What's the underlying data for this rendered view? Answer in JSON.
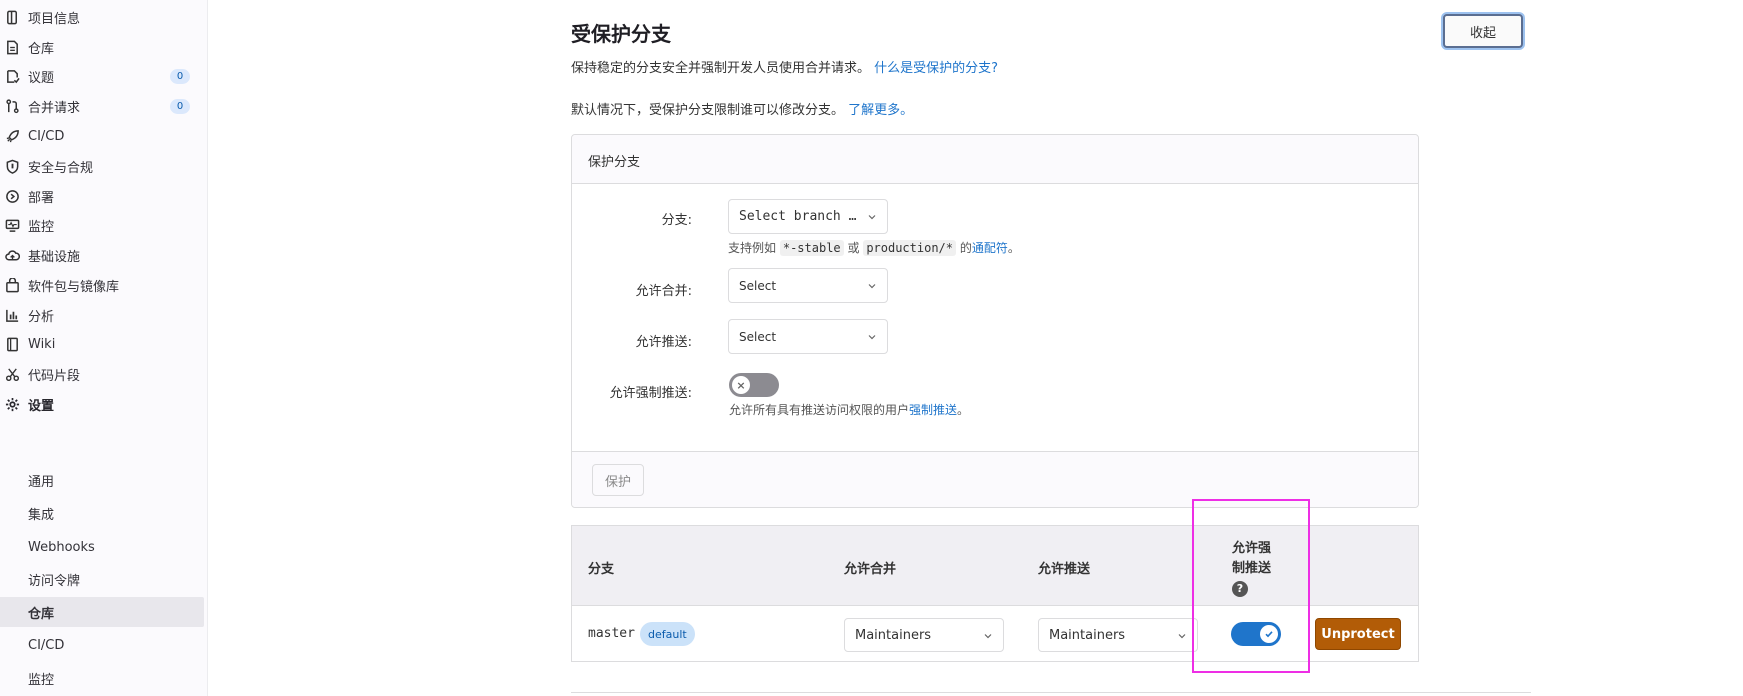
{
  "sidebar": {
    "items": [
      {
        "label": "项目信息",
        "icon": "project-info-icon"
      },
      {
        "label": "仓库",
        "icon": "repository-icon"
      },
      {
        "label": "议题",
        "icon": "issues-icon",
        "count": "0"
      },
      {
        "label": "合并请求",
        "icon": "merge-request-icon",
        "count": "0"
      },
      {
        "label": "CI/CD",
        "icon": "rocket-icon"
      },
      {
        "label": "安全与合规",
        "icon": "shield-icon"
      },
      {
        "label": "部署",
        "icon": "deployments-icon"
      },
      {
        "label": "监控",
        "icon": "monitor-icon"
      },
      {
        "label": "基础设施",
        "icon": "cloud-icon"
      },
      {
        "label": "软件包与镜像库",
        "icon": "package-icon"
      },
      {
        "label": "分析",
        "icon": "chart-icon"
      },
      {
        "label": "Wiki",
        "icon": "book-icon"
      },
      {
        "label": "代码片段",
        "icon": "scissors-icon"
      },
      {
        "label": "设置",
        "icon": "gear-icon"
      }
    ],
    "settings_sub": [
      "通用",
      "集成",
      "Webhooks",
      "访问令牌",
      "仓库",
      "CI/CD",
      "监控"
    ],
    "active_sub": "仓库"
  },
  "page": {
    "title": "受保护分支",
    "desc_text": "保持稳定的分支安全并强制开发人员使用合并请求。",
    "desc_link": "什么是受保护的分支?",
    "default_text": "默认情况下，受保护分支限制谁可以修改分支。",
    "default_link": "了解更多。",
    "collapse_label": "收起"
  },
  "form": {
    "header": "保护分支",
    "branch_label": "分支:",
    "branch_placeholder": "Select branch …",
    "branch_help_prefix": "支持例如",
    "branch_help_code1": "*-stable",
    "branch_help_or": "或",
    "branch_help_code2": "production/*",
    "branch_help_mid": "的",
    "branch_help_link": "通配符",
    "branch_help_end": "。",
    "merge_label": "允许合并:",
    "merge_value": "Select",
    "push_label": "允许推送:",
    "push_value": "Select",
    "force_label": "允许强制推送:",
    "force_help_prefix": "允许所有具有推送访问权限的用户",
    "force_help_link": "强制推送",
    "force_help_end": "。",
    "force_enabled": false,
    "protect_button": "保护"
  },
  "table": {
    "headers": {
      "branch": "分支",
      "merge": "允许合并",
      "push": "允许推送",
      "force_line1": "允许强",
      "force_line2": "制推送"
    },
    "rows": [
      {
        "branch": "master",
        "badge": "default",
        "merge": "Maintainers",
        "push": "Maintainers",
        "force": true,
        "action": "Unprotect"
      }
    ]
  },
  "colors": {
    "link": "#1f75cb",
    "toggle_on": "#1f75cb",
    "unprotect": "#b25c07",
    "highlight": "#ee2ee5"
  }
}
